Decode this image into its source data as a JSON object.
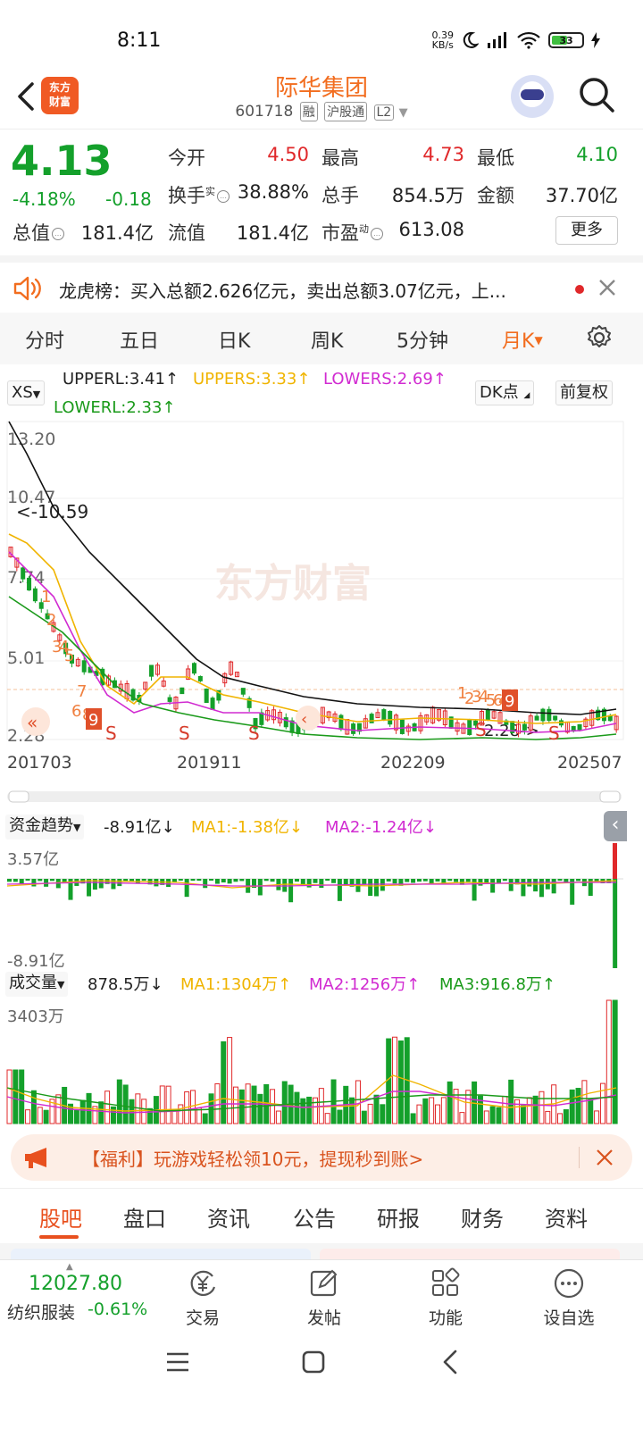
{
  "status": {
    "time": "8:11",
    "net_speed_top": "0.39",
    "net_speed_unit": "KB/s",
    "battery": "33"
  },
  "header": {
    "logo_line1": "东方",
    "logo_line2": "财富",
    "name": "际华集团",
    "code": "601718",
    "tags": [
      "融",
      "沪股通",
      "L2"
    ]
  },
  "quote": {
    "price": "4.13",
    "change_pct": "-4.18%",
    "change_amt": "-0.18",
    "rows": [
      [
        {
          "label": "今开",
          "value": "4.50",
          "color": "red"
        },
        {
          "label": "最高",
          "value": "4.73",
          "color": "red"
        },
        {
          "label": "最低",
          "value": "4.10",
          "color": "green"
        }
      ],
      [
        {
          "label": "换手",
          "sup": "实",
          "value": "38.88%",
          "color": "dark"
        },
        {
          "label": "总手",
          "value": "854.5万",
          "color": "dark"
        },
        {
          "label": "金额",
          "value": "37.70亿",
          "color": "dark"
        }
      ],
      [
        {
          "label": "总值",
          "value": "181.4亿",
          "color": "dark"
        },
        {
          "label": "流值",
          "value": "181.4亿",
          "color": "dark"
        },
        {
          "label": "市盈",
          "sup": "动",
          "value": "613.08",
          "color": "dark"
        }
      ]
    ],
    "more": "更多"
  },
  "notice": {
    "text": "龙虎榜：买入总额2.626亿元，卖出总额3.07亿元，上..."
  },
  "tabs": [
    "分时",
    "五日",
    "日K",
    "周K",
    "5分钟",
    "月K"
  ],
  "active_tab": "月K",
  "kline": {
    "selector": "XS",
    "upperl": "UPPERL:3.41↑",
    "uppers": "UPPERS:3.33↑",
    "lowers": "LOWERS:2.69↑",
    "lowerl": "LOWERL:2.33↑",
    "dk_button": "DK点",
    "fq_button": "前复权",
    "y_labels": [
      "13.20",
      "10.47",
      "7.74",
      "5.01",
      "2.28"
    ],
    "max_marker": "<-10.59",
    "min_marker": "2.28->",
    "x_labels": [
      "201703",
      "201911",
      "202209",
      "202507"
    ],
    "watermark": "东方财富",
    "sequence_marks": [
      "1",
      "2",
      "3",
      "4",
      "5",
      "6",
      "7",
      "8",
      "9",
      "1",
      "2",
      "3",
      "4",
      "5",
      "6",
      "4",
      "9"
    ],
    "sell_marks": [
      "S",
      "S",
      "S",
      "S",
      "S"
    ]
  },
  "fund": {
    "selector": "资金趋势",
    "value": "-8.91亿↓",
    "ma1": "MA1:-1.38亿↓",
    "ma2": "MA2:-1.24亿↓",
    "top": "3.57亿",
    "bottom": "-8.91亿"
  },
  "volume": {
    "selector": "成交量",
    "value": "878.5万↓",
    "ma1": "MA1:1304万↑",
    "ma2": "MA2:1256万↑",
    "ma3": "MA3:916.8万↑",
    "top": "3403万"
  },
  "promo": {
    "text": "【福利】玩游戏轻松领10元，提现秒到账>"
  },
  "subtabs": [
    "股吧",
    "盘口",
    "资讯",
    "公告",
    "研报",
    "财务",
    "资料"
  ],
  "bottombar": {
    "index_value": "12027.80",
    "index_name": "纺织服装",
    "index_change": "-0.61%",
    "items": [
      "交易",
      "发帖",
      "功能",
      "设自选"
    ]
  },
  "colors": {
    "accent": "#f26d1f",
    "up": "#e0282a",
    "down": "#14a02b",
    "ma_yellow": "#f0b400",
    "ma_magenta": "#d12bd1",
    "ma_green": "#1a9a1a"
  }
}
